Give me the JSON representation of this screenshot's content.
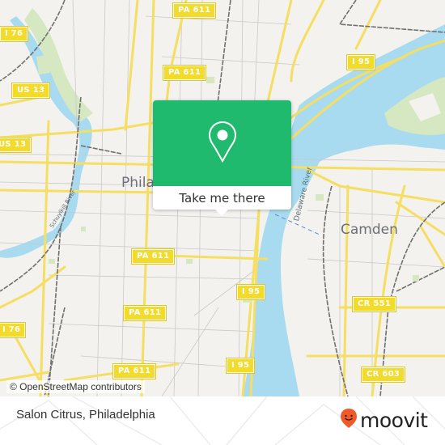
{
  "map": {
    "colors": {
      "land": "#f3f2ee",
      "water": "#a8dbef",
      "park": "#d5e8c2",
      "road_major": "#f5de62",
      "road_minor": "#c9c9c9",
      "rail": "#6f6f6f"
    },
    "route_shields": [
      {
        "label": "PA 611"
      },
      {
        "label": "PA 611"
      },
      {
        "label": "I 95"
      },
      {
        "label": "I 76"
      },
      {
        "label": "US 13"
      },
      {
        "label": "US 13"
      },
      {
        "label": "PA 611"
      },
      {
        "label": "PA 611"
      },
      {
        "label": "PA 611"
      },
      {
        "label": "I 95"
      },
      {
        "label": "I 95"
      },
      {
        "label": "CR 551"
      },
      {
        "label": "CR 603"
      },
      {
        "label": "I 76"
      }
    ],
    "place_labels": {
      "philadelphia": "Phila",
      "camden": "Camden"
    },
    "river_labels": {
      "delaware": "Delaware River",
      "schuylkill": "Schuylkill River"
    },
    "attribution": "© OpenStreetMap contributors"
  },
  "popup": {
    "icon": "map-pin-icon",
    "button_label": "Take me there",
    "accent_color": "#1fba6d"
  },
  "footer": {
    "title": "Salon Citrus, Philadelphia",
    "brand": "moovit",
    "brand_color": "#f05a28"
  }
}
